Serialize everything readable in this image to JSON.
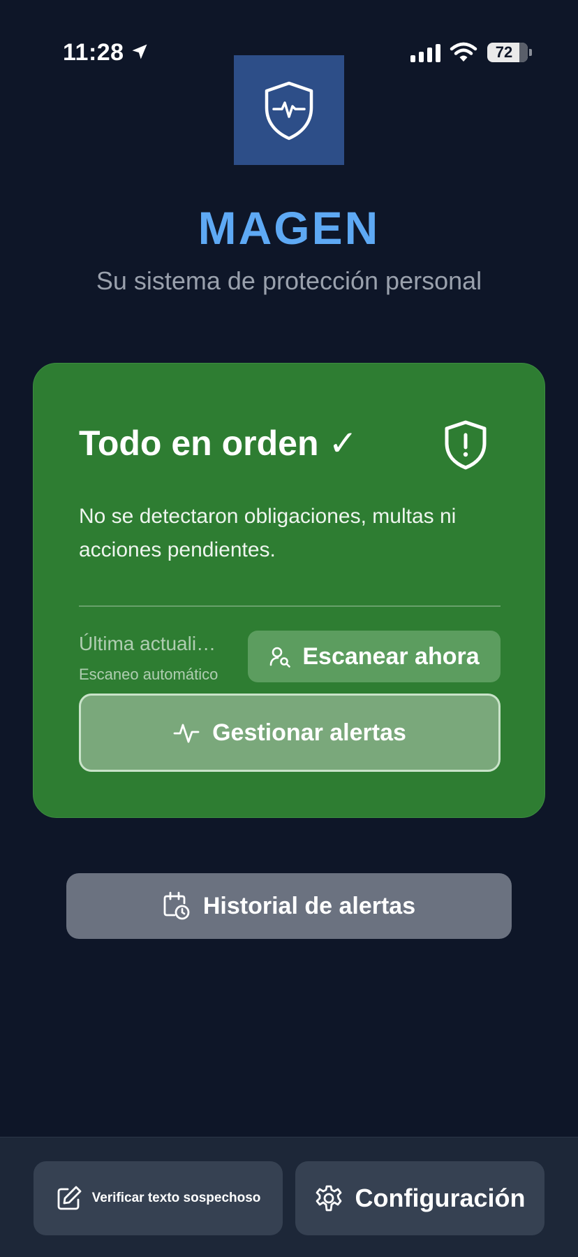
{
  "status_bar": {
    "time": "11:28",
    "battery": "72",
    "icons": [
      "location-arrow-icon",
      "cellular-signal-icon",
      "wifi-icon",
      "battery-icon"
    ]
  },
  "header": {
    "logo_icon": "shield-heartbeat-icon",
    "title": "MAGEN",
    "subtitle": "Su sistema de protección personal"
  },
  "status_card": {
    "title": "Todo en orden ✓",
    "icon": "shield-exclamation-icon",
    "description": "No se detectaron obligaciones, multas ni acciones pendientes.",
    "last_update": "Última actualización",
    "auto_scan": "Escaneo automático",
    "scan_button": {
      "label": "Escanear ahora",
      "icon": "user-search-icon"
    },
    "manage_button": {
      "label": "Gestionar alertas",
      "icon": "activity-icon"
    },
    "color": "#2e7d32"
  },
  "history_button": {
    "label": "Historial de alertas",
    "icon": "calendar-clock-icon"
  },
  "bottom_bar": {
    "verify_button": {
      "label": "Verificar texto sospechoso",
      "icon": "edit-icon"
    },
    "config_button": {
      "label": "Configuración",
      "icon": "gear-icon"
    }
  },
  "colors": {
    "background": "#0e1628",
    "accent": "#5ea9f4",
    "card_green": "#2e7d32",
    "history_gray": "#6b7280"
  }
}
